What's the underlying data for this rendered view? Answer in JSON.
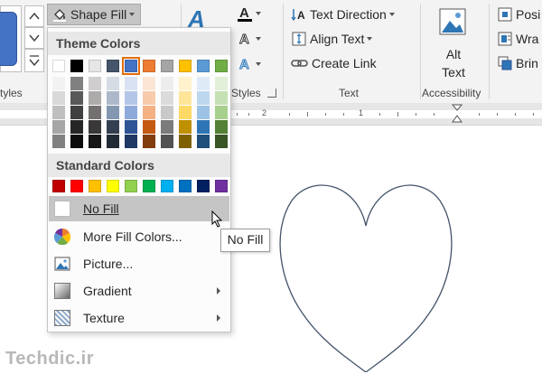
{
  "ribbon": {
    "styles_label": "tyles",
    "shape_fill_label": "Shape Fill",
    "wordart_styles_label": "Styles",
    "text_direction_label": "Text Direction",
    "align_text_label": "Align Text",
    "create_link_label": "Create Link",
    "text_group_label": "Text",
    "alt_text_line1": "Alt",
    "alt_text_line2": "Text",
    "accessibility_label": "Accessibility",
    "position_label": "Posi",
    "wrap_label": "Wra",
    "bring_label": "Brin"
  },
  "ruler": {
    "marks": [
      "2",
      "1"
    ]
  },
  "shape_fill_menu": {
    "theme_colors_header": "Theme Colors",
    "standard_colors_header": "Standard Colors",
    "theme_top_row": [
      "#ffffff",
      "#000000",
      "#e7e6e6",
      "#44546a",
      "#4472c4",
      "#ed7d31",
      "#a5a5a5",
      "#ffc000",
      "#5b9bd5",
      "#70ad47"
    ],
    "theme_shades": [
      [
        "#f2f2f2",
        "#d9d9d9",
        "#bfbfbf",
        "#a6a6a6",
        "#808080"
      ],
      [
        "#808080",
        "#595959",
        "#404040",
        "#262626",
        "#0d0d0d"
      ],
      [
        "#d0cece",
        "#aeabab",
        "#757070",
        "#3a3838",
        "#171616"
      ],
      [
        "#d6dce4",
        "#adb9ca",
        "#8497b0",
        "#333f50",
        "#222a35"
      ],
      [
        "#d9e2f3",
        "#b4c6e7",
        "#8eaadb",
        "#2f5496",
        "#1f3864"
      ],
      [
        "#fbe5d5",
        "#f7cbac",
        "#f4b183",
        "#c45911",
        "#833c0b"
      ],
      [
        "#ededed",
        "#dbdbdb",
        "#c9c9c9",
        "#7b7b7b",
        "#525252"
      ],
      [
        "#fff2cc",
        "#fee599",
        "#ffd965",
        "#bf9000",
        "#7f6000"
      ],
      [
        "#deeaf6",
        "#bdd7ee",
        "#9cc3e5",
        "#2e75b5",
        "#1e4e79"
      ],
      [
        "#e2efd9",
        "#c5e0b3",
        "#a8d08d",
        "#538135",
        "#375623"
      ]
    ],
    "selected_theme_index": 4,
    "standard_colors": [
      "#c00000",
      "#ff0000",
      "#ffc000",
      "#ffff00",
      "#92d050",
      "#00b050",
      "#00b0f0",
      "#0070c0",
      "#002060",
      "#7030a0"
    ],
    "items": [
      {
        "label": "No Fill",
        "icon": "no-fill-icon"
      },
      {
        "label": "More Fill Colors...",
        "icon": "color-wheel-icon"
      },
      {
        "label": "Picture...",
        "icon": "picture-icon"
      },
      {
        "label": "Gradient",
        "icon": "gradient-icon"
      },
      {
        "label": "Texture",
        "icon": "texture-icon"
      }
    ]
  },
  "tooltip": {
    "text": "No Fill"
  },
  "watermark": {
    "text": "Techdic.ir"
  },
  "colors": {
    "accent": "#4472c4",
    "heart_stroke": "#44546a",
    "hover": "#c5c5c5"
  }
}
